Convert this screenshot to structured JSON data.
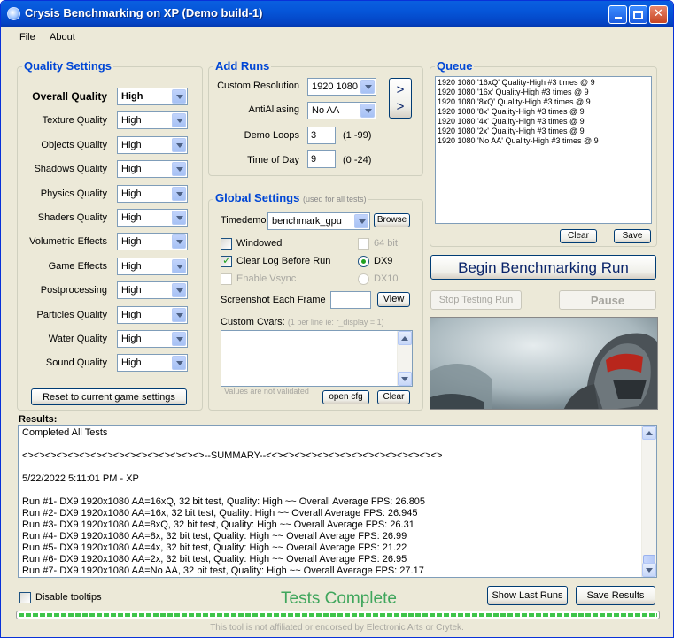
{
  "window": {
    "title": "Crysis Benchmarking on XP (Demo build-1)"
  },
  "menu": {
    "file": "File",
    "about": "About"
  },
  "quality": {
    "title": "Quality Settings",
    "rows": [
      {
        "label": "Overall Quality",
        "value": "High"
      },
      {
        "label": "Texture Quality",
        "value": "High"
      },
      {
        "label": "Objects Quality",
        "value": "High"
      },
      {
        "label": "Shadows Quality",
        "value": "High"
      },
      {
        "label": "Physics Quality",
        "value": "High"
      },
      {
        "label": "Shaders Quality",
        "value": "High"
      },
      {
        "label": "Volumetric Effects",
        "value": "High"
      },
      {
        "label": "Game Effects",
        "value": "High"
      },
      {
        "label": "Postprocessing",
        "value": "High"
      },
      {
        "label": "Particles Quality",
        "value": "High"
      },
      {
        "label": "Water Quality",
        "value": "High"
      },
      {
        "label": "Sound Quality",
        "value": "High"
      }
    ],
    "reset_label": "Reset to current game settings"
  },
  "add_runs": {
    "title": "Add Runs",
    "resolution_label": "Custom Resolution",
    "resolution_value": "1920 1080",
    "aa_label": "AntiAliasing",
    "aa_value": "No AA",
    "loops_label": "Demo Loops",
    "loops_value": "3",
    "loops_range": "(1 -99)",
    "tod_label": "Time of Day",
    "tod_value": "9",
    "tod_range": "(0 -24)",
    "add_glyph": ">\n>"
  },
  "global": {
    "title": "Global Settings",
    "subtitle": "(used for all tests)",
    "timedemo_label": "Timedemo",
    "timedemo_value": "benchmark_gpu",
    "browse_label": "Browse",
    "windowed_label": "Windowed",
    "clearlog_label": "Clear Log Before Run",
    "vsync_label": "Enable Vsync",
    "bit64_label": "64 bit",
    "dx9_label": "DX9",
    "dx10_label": "DX10",
    "screenshot_label": "Screenshot Each Frame",
    "view_label": "View",
    "cvars_label": "Custom Cvars:",
    "cvars_hint": "(1 per line ie: r_display = 1)",
    "not_validated": "Values are not validated",
    "opencfg_label": "open cfg",
    "clear_label": "Clear"
  },
  "queue": {
    "title": "Queue",
    "items": [
      "1920 1080 '16xQ' Quality-High #3 times @ 9",
      "1920 1080 '16x' Quality-High #3 times @ 9",
      "1920 1080 '8xQ' Quality-High #3 times @ 9",
      "1920 1080 '8x' Quality-High #3 times @ 9",
      "1920 1080 '4x' Quality-High #3 times @ 9",
      "1920 1080 '2x' Quality-High #3 times @ 9",
      "1920 1080 'No AA' Quality-High #3 times @ 9"
    ],
    "clear_label": "Clear",
    "save_label": "Save"
  },
  "actions": {
    "begin_label": "Begin Benchmarking Run",
    "stop_label": "Stop Testing Run",
    "pause_label": "Pause"
  },
  "results": {
    "label": "Results:",
    "lines": [
      "Completed All Tests",
      "",
      "<><><><><><><><><><><><><><><><>--SUMMARY--<<><><><><><><><><><><><><><><>",
      "",
      "5/22/2022 5:11:01 PM - XP",
      "",
      "Run #1- DX9 1920x1080 AA=16xQ, 32 bit test, Quality: High ~~ Overall Average FPS: 26.805",
      "Run #2- DX9 1920x1080 AA=16x, 32 bit test, Quality: High ~~ Overall Average FPS: 26.945",
      "Run #3- DX9 1920x1080 AA=8xQ, 32 bit test, Quality: High ~~ Overall Average FPS: 26.31",
      "Run #4- DX9 1920x1080 AA=8x, 32 bit test, Quality: High ~~ Overall Average FPS: 26.99",
      "Run #5- DX9 1920x1080 AA=4x, 32 bit test, Quality: High ~~ Overall Average FPS: 21.22",
      "Run #6- DX9 1920x1080 AA=2x, 32 bit test, Quality: High ~~ Overall Average FPS: 26.95",
      "Run #7- DX9 1920x1080 AA=No AA, 32 bit test, Quality: High ~~ Overall Average FPS: 27.17"
    ]
  },
  "bottom": {
    "tooltips_label": "Disable tooltips",
    "status": "Tests Complete",
    "show_last_label": "Show Last Runs",
    "save_results_label": "Save Results",
    "progress": 1.0,
    "footer": "This tool is not affiliated or endorsed by Electronic Arts or Crytek."
  },
  "colors": {
    "accent": "#0046D5",
    "status_green": "#3FA65C",
    "titlebar": "#0555D8"
  }
}
